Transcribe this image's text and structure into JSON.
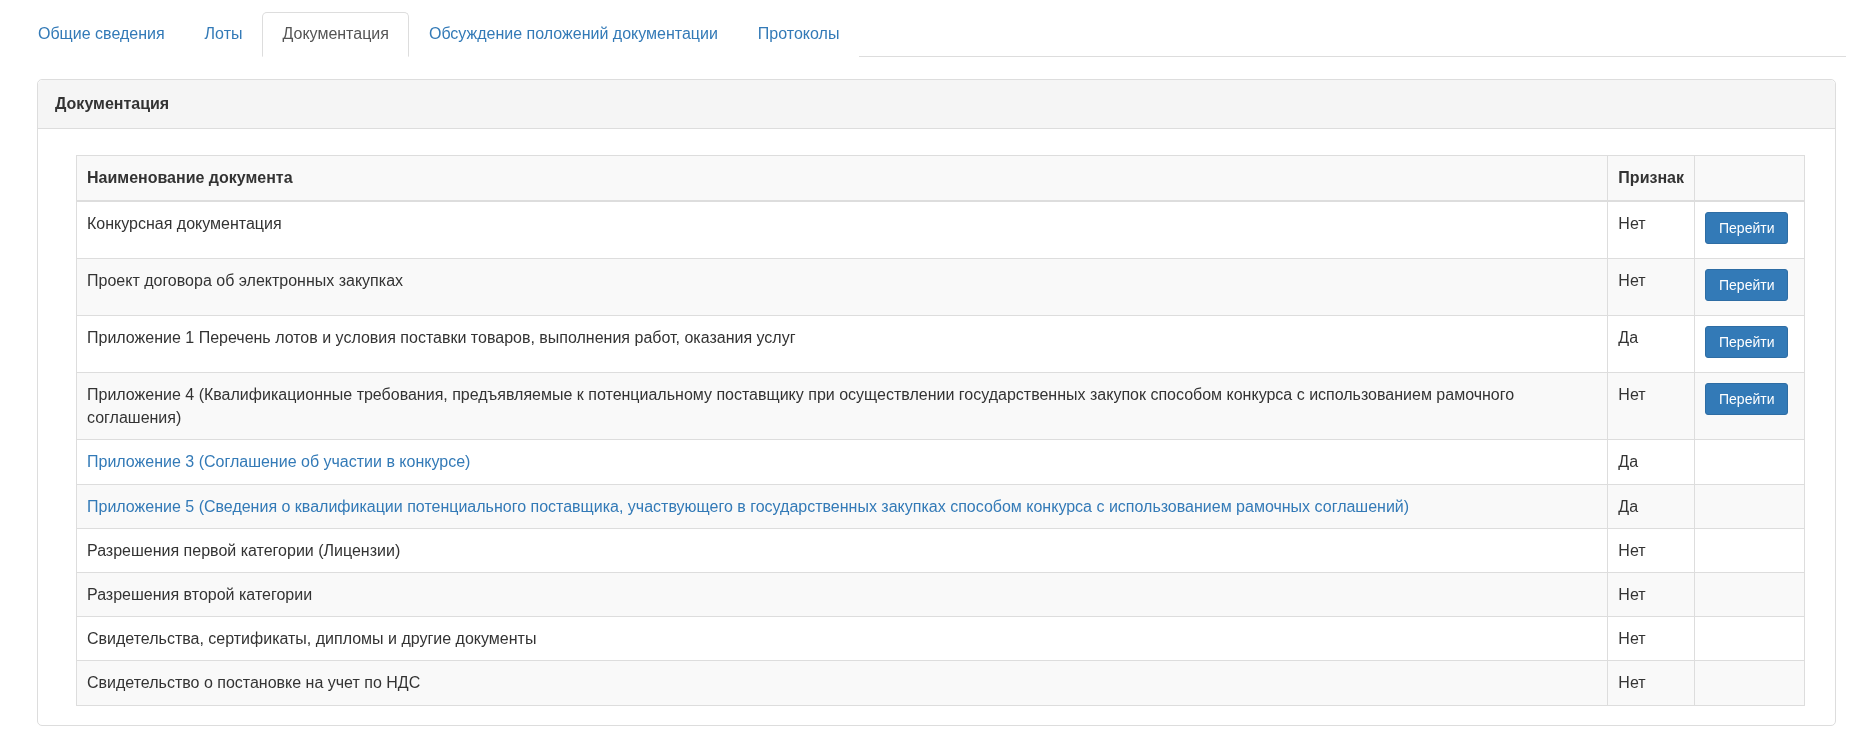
{
  "tabs": [
    {
      "label": "Общие сведения",
      "selected": false
    },
    {
      "label": "Лоты",
      "selected": false
    },
    {
      "label": "Документация",
      "selected": true
    },
    {
      "label": "Обсуждение положений документации",
      "selected": false
    },
    {
      "label": "Протоколы",
      "selected": false
    }
  ],
  "panel": {
    "title": "Документация",
    "table": {
      "columns": [
        "Наименование документа",
        "Признак"
      ],
      "rows": [
        {
          "name": "Конкурсная документация",
          "kind": "text",
          "sign": "Нет",
          "action": "Перейти"
        },
        {
          "name": "Проект договора об электронных закупках",
          "kind": "text",
          "sign": "Нет",
          "action": "Перейти"
        },
        {
          "name": "Приложение 1 Перечень лотов и условия поставки товаров, выполнения работ, оказания услуг",
          "kind": "text",
          "sign": "Да",
          "action": "Перейти"
        },
        {
          "name": "Приложение 4 (Квалификационные требования, предъявляемые к потенциальному поставщику при осуществлении государственных закупок способом конкурса с использованием рамочного соглашения)",
          "kind": "text",
          "sign": "Нет",
          "action": "Перейти"
        },
        {
          "name": "Приложение 3 (Соглашение об участии в конкурсе)",
          "kind": "link",
          "sign": "Да"
        },
        {
          "name": "Приложение 5 (Сведения о квалификации потенциального поставщика, участвующего в государственных закупках способом конкурса с использованием рамочных соглашений)",
          "kind": "link",
          "sign": "Да"
        },
        {
          "name": "Разрешения первой категории (Лицензии)",
          "kind": "text",
          "sign": "Нет"
        },
        {
          "name": "Разрешения второй категории",
          "kind": "text",
          "sign": "Нет"
        },
        {
          "name": "Свидетельства, сертификаты, дипломы и другие документы",
          "kind": "text",
          "sign": "Нет"
        },
        {
          "name": "Свидетельство о постановке на учет по НДС",
          "kind": "text",
          "sign": "Нет"
        }
      ]
    }
  }
}
